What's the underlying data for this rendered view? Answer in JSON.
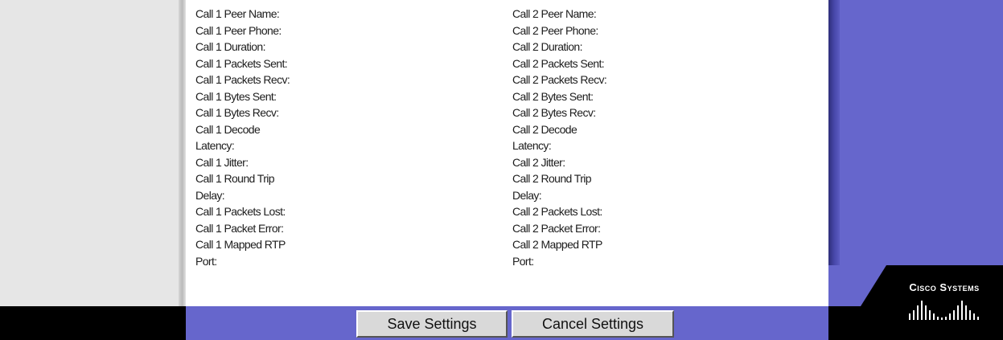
{
  "stats": {
    "call1": [
      "Call 1 Peer Name:",
      "Call 1 Peer Phone:",
      "Call 1 Duration:",
      "Call 1 Packets Sent:",
      "Call 1 Packets Recv:",
      "Call 1 Bytes Sent:",
      "Call 1 Bytes Recv:",
      "Call 1 Decode",
      "Latency:",
      "Call 1 Jitter:",
      "Call 1 Round Trip",
      "Delay:",
      "Call 1 Packets Lost:",
      "Call 1 Packet Error:",
      "Call 1 Mapped RTP",
      "Port:"
    ],
    "call2": [
      "Call 2 Peer Name:",
      "Call 2 Peer Phone:",
      "Call 2 Duration:",
      "Call 2 Packets Sent:",
      "Call 2 Packets Recv:",
      "Call 2 Bytes Sent:",
      "Call 2 Bytes Recv:",
      "Call 2 Decode",
      "Latency:",
      "Call 2 Jitter:",
      "Call 2 Round Trip",
      "Delay:",
      "Call 2 Packets Lost:",
      "Call 2 Packet Error:",
      "Call 2 Mapped RTP",
      "Port:"
    ]
  },
  "buttons": {
    "save": "Save Settings",
    "cancel": "Cancel Settings"
  },
  "brand": {
    "name": "Cisco Systems",
    "logo_icon": "cisco-bridge-icon"
  },
  "colors": {
    "accent": "#6666cc",
    "panel": "#e6e6e6"
  }
}
